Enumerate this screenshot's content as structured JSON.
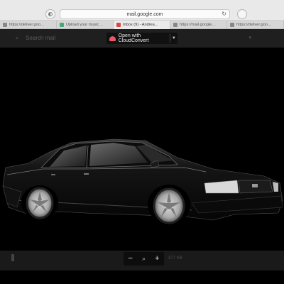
{
  "browser": {
    "address": "mail.google.com",
    "tabs": [
      {
        "label": "https://deliver.goo…"
      },
      {
        "label": "Upload your music…"
      },
      {
        "label": "Inbox (9) - Andrea…",
        "active": true
      },
      {
        "label": "https://mail.google…"
      },
      {
        "label": "https://deliver.goo…"
      }
    ]
  },
  "viewer": {
    "search_placeholder": "Search mail",
    "open_with_label": "Open with CloudConvert",
    "size_label": "377 KB"
  }
}
